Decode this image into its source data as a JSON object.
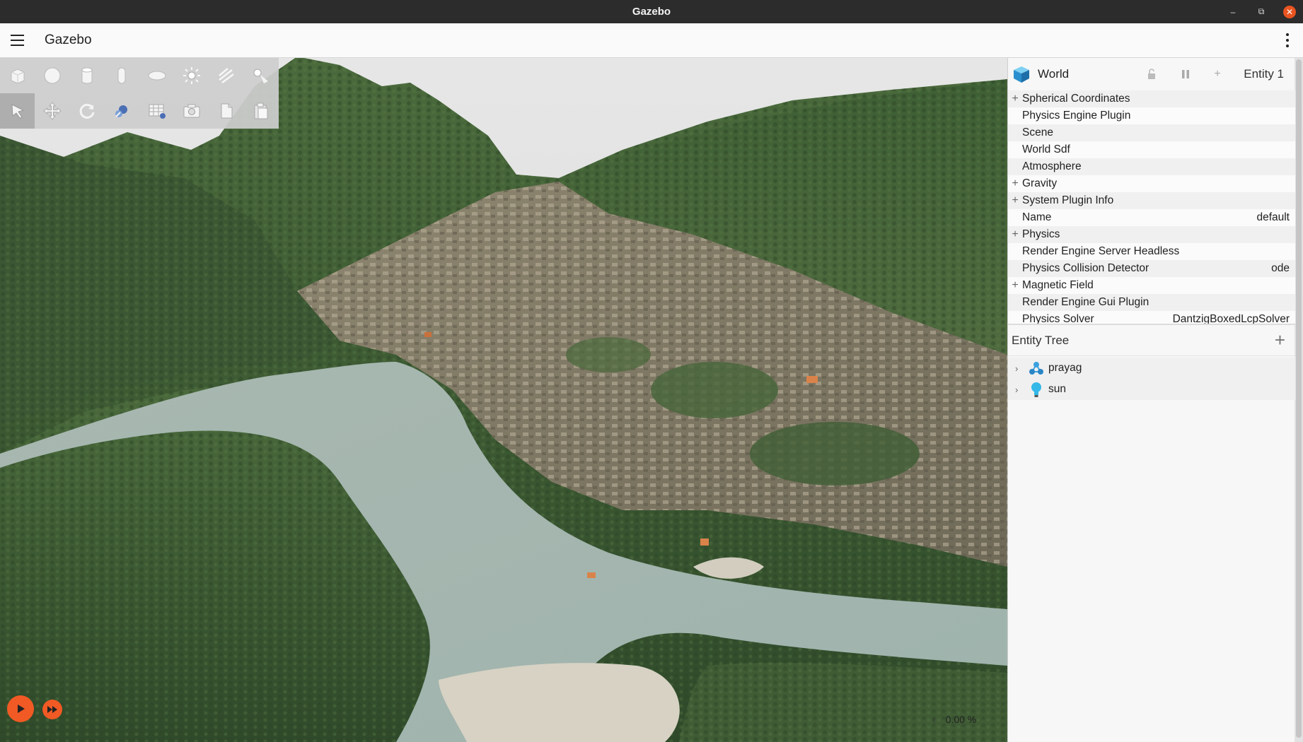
{
  "window": {
    "title": "Gazebo",
    "controls": [
      "minimize-icon",
      "restore-icon",
      "close-icon"
    ]
  },
  "appbar": {
    "title": "Gazebo",
    "menu_icon": "hamburger-menu-icon",
    "overflow_icon": "kebab-menu-icon"
  },
  "toolbar": {
    "row1": [
      "box-shape-icon",
      "sphere-shape-icon",
      "cylinder-shape-icon",
      "capsule-shape-icon",
      "ellipsoid-shape-icon",
      "point-light-icon",
      "directional-light-icon",
      "spot-light-icon"
    ],
    "row2": [
      "select-tool-icon",
      "translate-tool-icon",
      "rotate-tool-icon",
      "transform-control-icon",
      "grid-snap-icon",
      "screenshot-icon",
      "copy-icon",
      "paste-icon"
    ],
    "active": "select-tool-icon"
  },
  "playback": {
    "play_icon": "play-icon",
    "step_icon": "fast-forward-icon",
    "rtf_value": "0.00 %",
    "rtf_chevron": "‹"
  },
  "component_inspector": {
    "entity_name": "World",
    "entity_id_label": "Entity 1",
    "properties": [
      {
        "label": "Spherical Coordinates",
        "expandable": true,
        "value": ""
      },
      {
        "label": "Physics Engine Plugin",
        "expandable": false,
        "value": ""
      },
      {
        "label": "Scene",
        "expandable": false,
        "value": ""
      },
      {
        "label": "World Sdf",
        "expandable": false,
        "value": ""
      },
      {
        "label": "Atmosphere",
        "expandable": false,
        "value": ""
      },
      {
        "label": "Gravity",
        "expandable": true,
        "value": ""
      },
      {
        "label": "System Plugin Info",
        "expandable": true,
        "value": ""
      },
      {
        "label": "Name",
        "expandable": false,
        "value": "default"
      },
      {
        "label": "Physics",
        "expandable": true,
        "value": ""
      },
      {
        "label": "Render Engine Server Headless",
        "expandable": false,
        "value": ""
      },
      {
        "label": "Physics Collision Detector",
        "expandable": false,
        "value": "ode"
      },
      {
        "label": "Magnetic Field",
        "expandable": true,
        "value": ""
      },
      {
        "label": "Render Engine Gui Plugin",
        "expandable": false,
        "value": ""
      },
      {
        "label": "Physics Solver",
        "expandable": false,
        "value": "DantzigBoxedLcpSolver"
      }
    ]
  },
  "entity_tree": {
    "title": "Entity Tree",
    "add_label": "+",
    "items": [
      {
        "label": "prayag",
        "icon": "model-icon"
      },
      {
        "label": "sun",
        "icon": "light-bulb-icon"
      }
    ]
  },
  "colors": {
    "accent": "#f15a24",
    "titlebar": "#2c2c2c",
    "toolbar_bg": "#cdcdcd",
    "panel_bg": "#f7f7f7"
  }
}
